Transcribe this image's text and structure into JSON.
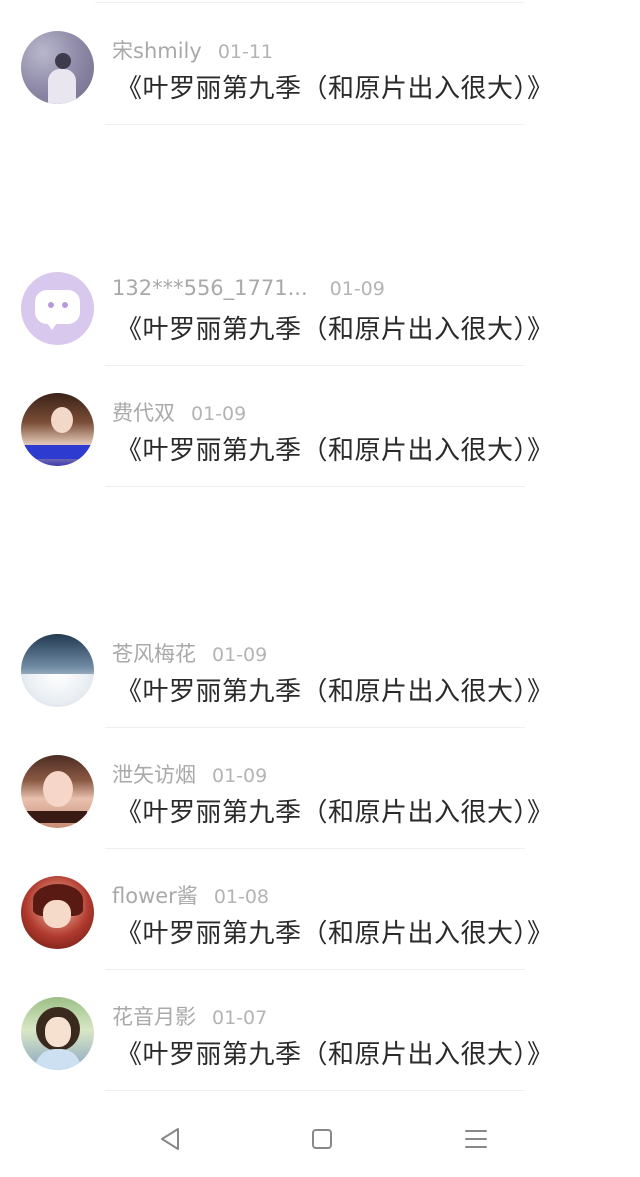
{
  "comments": [
    {
      "user": "宋shmily",
      "date": "01-11",
      "text": "《叶罗丽第九季（和原片出入很大）》",
      "avatar": "user-photo"
    },
    {
      "user": "132***556_1771...",
      "date": "01-09",
      "text": "《叶罗丽第九季（和原片出入很大）》",
      "avatar": "chat-bubble"
    },
    {
      "user": "费代双",
      "date": "01-09",
      "text": "《叶罗丽第九季（和原片出入很大）》",
      "avatar": "user-photo"
    },
    {
      "user": "苍风梅花",
      "date": "01-09",
      "text": "《叶罗丽第九季（和原片出入很大）》",
      "avatar": "sky-photo"
    },
    {
      "user": "泄矢访烟",
      "date": "01-09",
      "text": "《叶罗丽第九季（和原片出入很大）》",
      "avatar": "user-photo"
    },
    {
      "user": "flower酱",
      "date": "01-08",
      "text": "《叶罗丽第九季（和原片出入很大）》",
      "avatar": "anime-character"
    },
    {
      "user": "花音月影",
      "date": "01-07",
      "text": "《叶罗丽第九季（和原片出入很大）》",
      "avatar": "anime-character"
    }
  ],
  "navbar": {
    "back_icon": "triangle-back-icon",
    "home_icon": "square-home-icon",
    "menu_icon": "menu-lines-icon"
  }
}
